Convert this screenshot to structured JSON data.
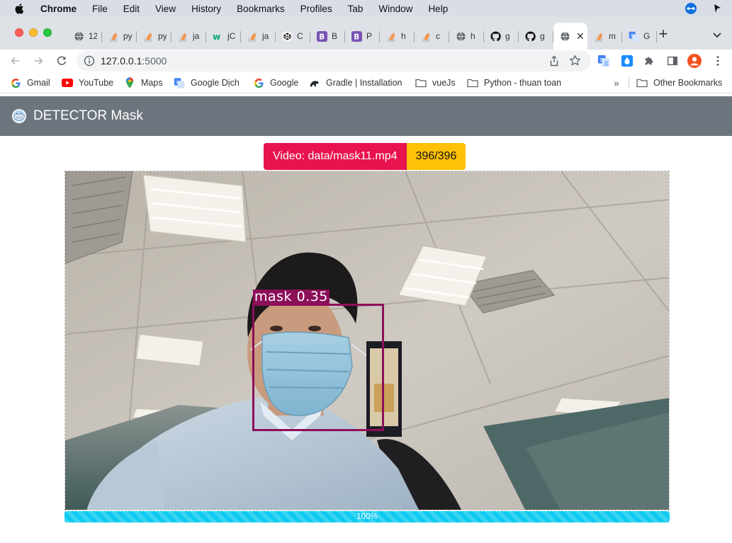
{
  "menubar": {
    "app": "Chrome",
    "items": [
      "File",
      "Edit",
      "View",
      "History",
      "Bookmarks",
      "Profiles",
      "Tab",
      "Window",
      "Help"
    ]
  },
  "tabs": [
    {
      "icon": "globe-icon",
      "label": "12"
    },
    {
      "icon": "stackoverflow-icon",
      "label": "py"
    },
    {
      "icon": "stackoverflow-icon",
      "label": "py"
    },
    {
      "icon": "stackoverflow-icon",
      "label": "ja"
    },
    {
      "icon": "w3schools-icon",
      "label": "jC"
    },
    {
      "icon": "stackoverflow-icon",
      "label": "ja"
    },
    {
      "icon": "codepen-icon",
      "label": "C"
    },
    {
      "icon": "bootstrap-icon",
      "label": "B"
    },
    {
      "icon": "bootstrap-icon",
      "label": "P"
    },
    {
      "icon": "stackoverflow-icon",
      "label": "h"
    },
    {
      "icon": "stackoverflow-icon",
      "label": "c"
    },
    {
      "icon": "globe-icon",
      "label": "h"
    },
    {
      "icon": "github-icon",
      "label": "g"
    },
    {
      "icon": "github-icon",
      "label": "g"
    }
  ],
  "active_tab": {
    "icon": "globe-icon",
    "close": "✕"
  },
  "tabs_after": [
    {
      "icon": "stackoverflow-icon",
      "label": "m"
    },
    {
      "icon": "google-translate-icon",
      "label": "G"
    }
  ],
  "toolbar": {
    "url_host": "127.0.0.1",
    "url_port": ":5000"
  },
  "bookmarks": [
    {
      "icon": "google-icon",
      "label": "Gmail"
    },
    {
      "icon": "youtube-icon",
      "label": "YouTube"
    },
    {
      "icon": "maps-icon",
      "label": "Maps"
    },
    {
      "icon": "google-translate-icon",
      "label": "Google Dịch"
    },
    {
      "icon": "google-icon",
      "label": "Google"
    },
    {
      "icon": "gradle-icon",
      "label": "Gradle | Installation"
    },
    {
      "icon": "folder-icon",
      "label": "vueJs"
    },
    {
      "icon": "folder-icon",
      "label": "Python - thuan toan"
    }
  ],
  "bookmarks_more": "»",
  "other_bookmarks": "Other Bookmarks",
  "app": {
    "brand": "DETECTOR Mask",
    "video_badge": "Video: data/mask11.mp4",
    "frame_badge": "396/396",
    "detection_label": "mask  0.35",
    "progress": 1.0,
    "progress_text": "100%",
    "colors": {
      "navbar": "#6c757d",
      "video_badge": "#e8124f",
      "frame_badge": "#ffc107",
      "detection_box": "#8c0f5a",
      "progress": "#0dcaf0"
    }
  }
}
